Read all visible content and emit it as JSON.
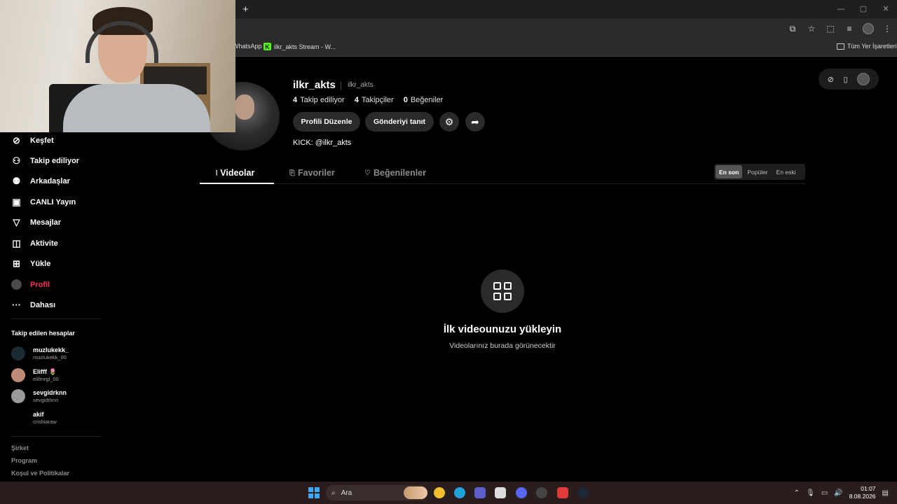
{
  "browser": {
    "new_tab": "+",
    "window_controls": [
      "—",
      "▢",
      "✕"
    ],
    "bookmarks": [
      {
        "label": "WhatsApp"
      },
      {
        "label": "ilkr_akts Stream - W..."
      }
    ],
    "bookmarks_folder": "Tüm Yer İşaretleri"
  },
  "sidebar": {
    "items": [
      {
        "label": "Keşfet",
        "icon": "compass-icon"
      },
      {
        "label": "Takip ediliyor",
        "icon": "user-follow-icon"
      },
      {
        "label": "Arkadaşlar",
        "icon": "friends-icon"
      },
      {
        "label": "CANLI Yayın",
        "icon": "live-icon"
      },
      {
        "label": "Mesajlar",
        "icon": "send-icon"
      },
      {
        "label": "Aktivite",
        "icon": "activity-icon"
      },
      {
        "label": "Yükle",
        "icon": "upload-icon"
      },
      {
        "label": "Profil",
        "icon": "avatar-icon"
      },
      {
        "label": "Dahası",
        "icon": "more-icon"
      }
    ],
    "following_title": "Takip edilen hesaplar",
    "accounts": [
      {
        "name": "muzlukekk_",
        "username": "muzlukekk_00"
      },
      {
        "name": "Elifff 🌷",
        "username": "elifmrgl_00"
      },
      {
        "name": "sevgidrknn",
        "username": "sevgidrknn"
      },
      {
        "name": "akif",
        "username": "crishiaraw"
      }
    ],
    "footer": [
      "Şirket",
      "Program",
      "Koşul ve Politikalar"
    ]
  },
  "profile": {
    "username": "ilkr_akts",
    "handle": "ilkr_akts",
    "stats": [
      {
        "count": "4",
        "label": "Takip ediliyor"
      },
      {
        "count": "4",
        "label": "Takipçiler"
      },
      {
        "count": "0",
        "label": "Beğeniler"
      }
    ],
    "edit_button": "Profili Düzenle",
    "promote_button": "Gönderiyi tanıt",
    "bio": "KICK: @ilkr_akts"
  },
  "tabs": [
    {
      "label": "Videolar",
      "icon": "grid-bars-icon"
    },
    {
      "label": "Favoriler",
      "icon": "bookmark-icon"
    },
    {
      "label": "Beğenilenler",
      "icon": "heart-outline-icon"
    }
  ],
  "sort": [
    "En son",
    "Popüler",
    "En eski"
  ],
  "empty_state": {
    "title": "İlk videounuzu yükleyin",
    "subtitle": "Videolarınız burada görünecektir"
  },
  "taskbar": {
    "search_placeholder": "Ara",
    "time": "01:07",
    "date": "8.08.2026"
  },
  "colors": {
    "accent": "#fe2c55",
    "background": "#000000",
    "button": "#2a2a2a"
  }
}
